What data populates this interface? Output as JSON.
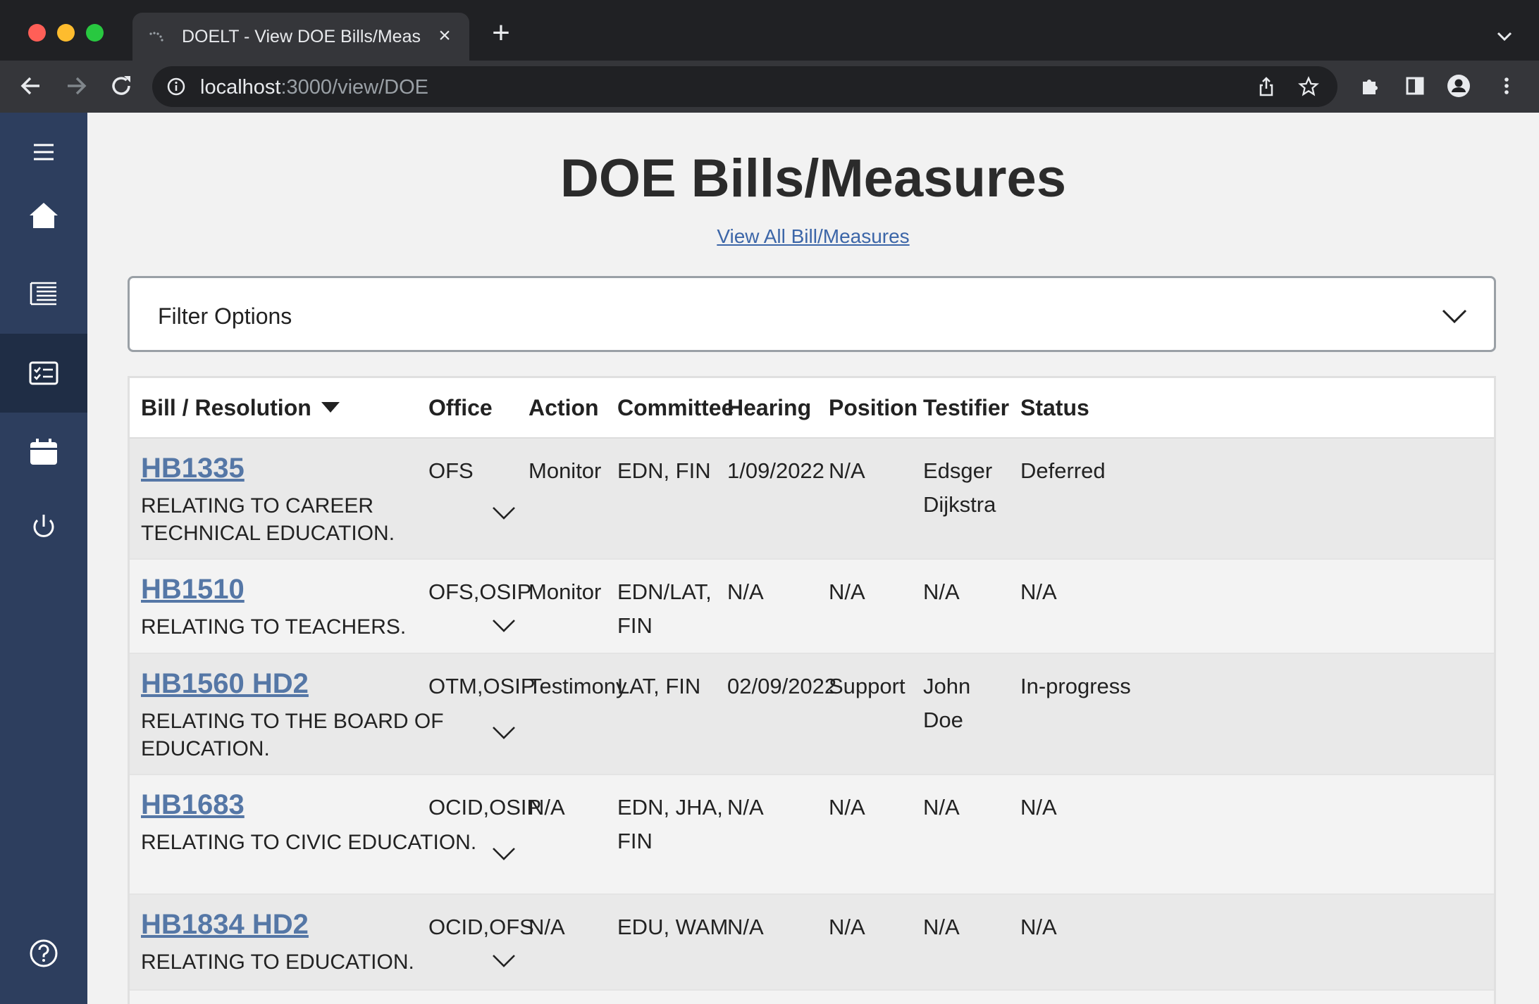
{
  "browser": {
    "tab_title": "DOELT - View DOE Bills/Measures",
    "url_host": "localhost",
    "url_path": ":3000/view/DOE"
  },
  "sidebar": {
    "items": [
      {
        "name": "menu",
        "icon": "hamburger-menu-icon"
      },
      {
        "name": "home",
        "icon": "home-icon"
      },
      {
        "name": "list",
        "icon": "list-icon"
      },
      {
        "name": "checklist",
        "icon": "checklist-icon",
        "active": true
      },
      {
        "name": "calendar",
        "icon": "calendar-icon"
      },
      {
        "name": "logout",
        "icon": "power-icon"
      },
      {
        "name": "help",
        "icon": "help-icon"
      }
    ]
  },
  "page": {
    "title": "DOE Bills/Measures",
    "view_all_link": "View All Bill/Measures",
    "filter_label": "Filter Options"
  },
  "table": {
    "headers": {
      "bill": "Bill / Resolution",
      "office": "Office",
      "action": "Action",
      "committee": "Committee",
      "hearing": "Hearing",
      "position": "Position",
      "testifier": "Testifier",
      "status": "Status"
    },
    "rows": [
      {
        "bill": "HB1335",
        "title": "RELATING TO CAREER TECHNICAL EDUCATION.",
        "office": "OFS",
        "action": "Monitor",
        "committee": "EDN, FIN",
        "hearing": "1/09/2022",
        "position": "N/A",
        "testifier": "Edsger Dijkstra",
        "status": "Deferred"
      },
      {
        "bill": "HB1510",
        "title": "RELATING TO TEACHERS.",
        "office": "OFS,OSIP",
        "action": "Monitor",
        "committee": "EDN/LAT, FIN",
        "hearing": "N/A",
        "position": "N/A",
        "testifier": "N/A",
        "status": "N/A"
      },
      {
        "bill": "HB1560 HD2",
        "title": "RELATING TO THE BOARD OF EDUCATION.",
        "office": "OTM,OSIP",
        "action": "Testimony",
        "committee": "LAT, FIN",
        "hearing": "02/09/2022",
        "position": "Support",
        "testifier": "John Doe",
        "status": "In-progress"
      },
      {
        "bill": "HB1683",
        "title": "RELATING TO CIVIC EDUCATION.",
        "office": "OCID,OSIP",
        "action": "N/A",
        "committee": "EDN, JHA, FIN",
        "hearing": "N/A",
        "position": "N/A",
        "testifier": "N/A",
        "status": "N/A"
      },
      {
        "bill": "HB1834 HD2",
        "title": "RELATING TO EDUCATION.",
        "office": "OCID,OFS",
        "action": "N/A",
        "committee": "EDU, WAM",
        "hearing": "N/A",
        "position": "N/A",
        "testifier": "N/A",
        "status": "N/A"
      }
    ]
  },
  "colors": {
    "sidebar": "#2d3e5e",
    "link": "#5577a6",
    "row_shade": "#e9e9e9"
  }
}
